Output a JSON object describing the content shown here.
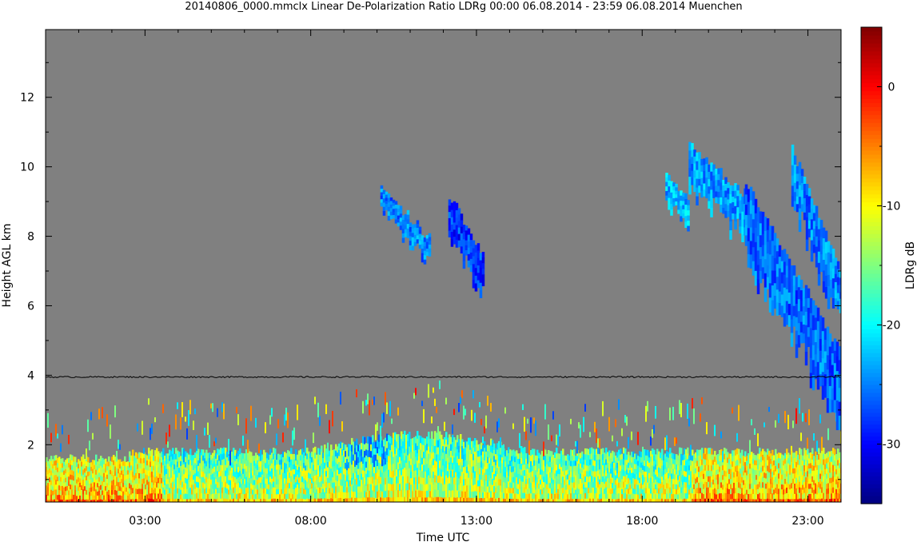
{
  "chart_data": {
    "type": "heatmap",
    "title": "20140806_0000.mmclx Linear De-Polarization Ratio LDRg   00:00 06.08.2014 - 23:59 06.08.2014 Muenchen",
    "xlabel": "Time UTC",
    "ylabel": "Height AGL km",
    "xlim_hours": [
      0.0,
      24.0
    ],
    "ylim_km": [
      0.35,
      13.95
    ],
    "x_ticks": [
      {
        "value": 3,
        "label": "03:00"
      },
      {
        "value": 8,
        "label": "08:00"
      },
      {
        "value": 13,
        "label": "13:00"
      },
      {
        "value": 18,
        "label": "18:00"
      },
      {
        "value": 23,
        "label": "23:00"
      }
    ],
    "y_ticks": [
      {
        "value": 2,
        "label": "2"
      },
      {
        "value": 4,
        "label": "4"
      },
      {
        "value": 6,
        "label": "6"
      },
      {
        "value": 8,
        "label": "8"
      },
      {
        "value": 10,
        "label": "10"
      },
      {
        "value": 12,
        "label": "12"
      }
    ],
    "colorbar": {
      "label": "LDRg dB",
      "range": [
        -35,
        5
      ],
      "ticks": [
        {
          "value": 0,
          "label": "0"
        },
        {
          "value": -10,
          "label": "-10"
        },
        {
          "value": -20,
          "label": "-20"
        },
        {
          "value": -30,
          "label": "-30"
        }
      ],
      "colormap": "jet"
    },
    "background_color": "#808080",
    "boundary_line": {
      "height_km": 3.95,
      "color": "#000000"
    },
    "clouds": [
      {
        "t0": 10.1,
        "t1": 11.6,
        "top_start": 9.4,
        "top_end": 7.9,
        "thickness": 0.8,
        "ldr": -25
      },
      {
        "t0": 12.15,
        "t1": 13.2,
        "top_start": 9.2,
        "top_end": 7.4,
        "thickness": 1.4,
        "ldr": -28
      },
      {
        "t0": 18.7,
        "t1": 19.4,
        "top_start": 9.8,
        "top_end": 9.0,
        "thickness": 1.0,
        "ldr": -23
      },
      {
        "t0": 19.4,
        "t1": 21.1,
        "top_start": 10.6,
        "top_end": 9.2,
        "thickness": 1.6,
        "ldr": -24
      },
      {
        "t0": 21.1,
        "t1": 24.0,
        "top_start": 9.6,
        "top_end": 4.6,
        "thickness": 2.6,
        "ldr": -26
      },
      {
        "t0": 22.5,
        "t1": 24.0,
        "top_start": 10.5,
        "top_end": 7.0,
        "thickness": 2.0,
        "ldr": -25
      }
    ],
    "boundary_layer": {
      "base_km": 0.4,
      "top_km": 1.8,
      "top_peak_km": 2.3,
      "peak_t0": 8.0,
      "peak_t1": 14.5
    }
  }
}
